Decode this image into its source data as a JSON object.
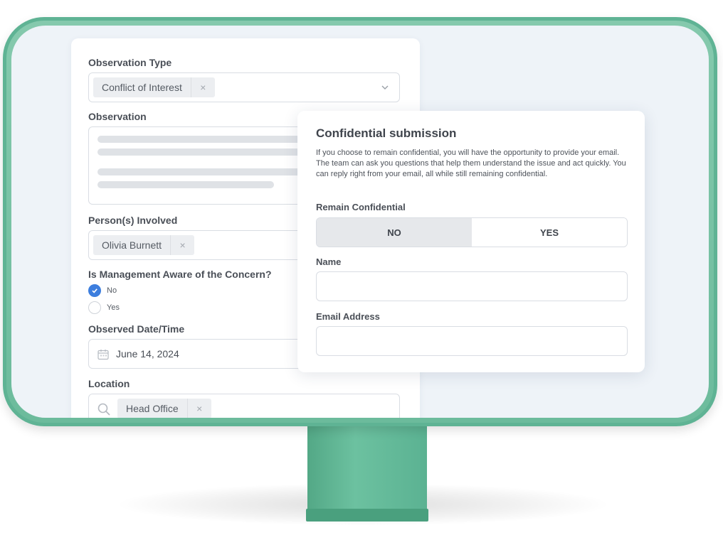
{
  "form": {
    "observation_type_label": "Observation Type",
    "observation_type_chip": "Conflict of Interest",
    "observation_label": "Observation",
    "persons_label": "Person(s) Involved",
    "person_chip": "Olivia Burnett",
    "management_label": "Is Management Aware of the Concern?",
    "management_options": [
      {
        "label": "No",
        "checked": true
      },
      {
        "label": "Yes",
        "checked": false
      }
    ],
    "date_label": "Observed Date/Time",
    "date_value": "June 14, 2024",
    "location_label": "Location",
    "location_chip": "Head Office",
    "remove_symbol": "×"
  },
  "confidential": {
    "title": "Confidential submission",
    "description": "If you choose to remain confidential, you will have the opportunity to provide your email. The team can ask you questions that help them understand the issue and act quickly. You can reply right from your email, all while still remaining confidential.",
    "remain_label": "Remain Confidential",
    "no_label": "NO",
    "yes_label": "YES",
    "selected": "NO",
    "name_label": "Name",
    "name_value": "",
    "email_label": "Email Address",
    "email_value": ""
  },
  "colors": {
    "monitor": "#6cbb9c",
    "accent": "#3d7ede",
    "screen": "#eef3f8"
  },
  "icons": [
    "chevron-down-icon",
    "close-icon",
    "check-icon",
    "calendar-icon",
    "search-icon"
  ]
}
